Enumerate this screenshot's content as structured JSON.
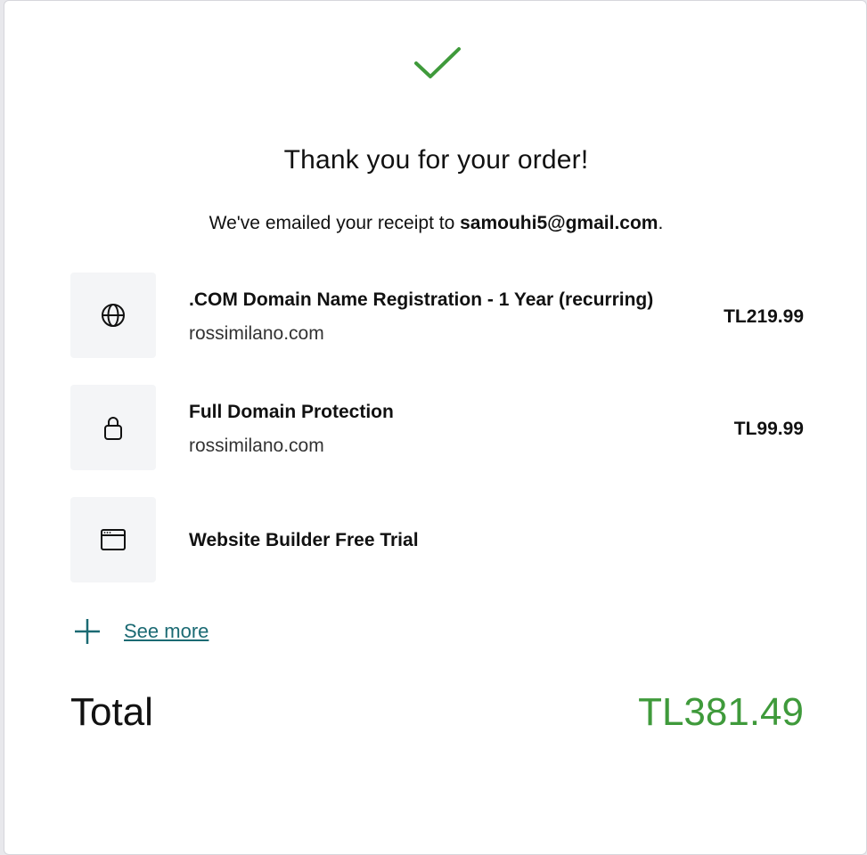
{
  "header": {
    "title": "Thank you for your order!",
    "receipt_prefix": "We've emailed your receipt to ",
    "receipt_email": "samouhi5@gmail.com",
    "receipt_suffix": "."
  },
  "items": [
    {
      "icon": "globe-icon",
      "name": ".COM Domain Name Registration - 1 Year (recurring)",
      "subtitle": "rossimilano.com",
      "price": "TL219.99"
    },
    {
      "icon": "lock-icon",
      "name": "Full Domain Protection",
      "subtitle": "rossimilano.com",
      "price": "TL99.99"
    },
    {
      "icon": "browser-window-icon",
      "name": "Website Builder Free Trial",
      "subtitle": "",
      "price": ""
    }
  ],
  "see_more": {
    "label": "See more",
    "icon": "plus-icon"
  },
  "total": {
    "label": "Total",
    "value": "TL381.49"
  },
  "colors": {
    "success_green": "#3f9a3b",
    "link_teal": "#1b6a73",
    "icon_box_bg": "#f4f5f7"
  }
}
